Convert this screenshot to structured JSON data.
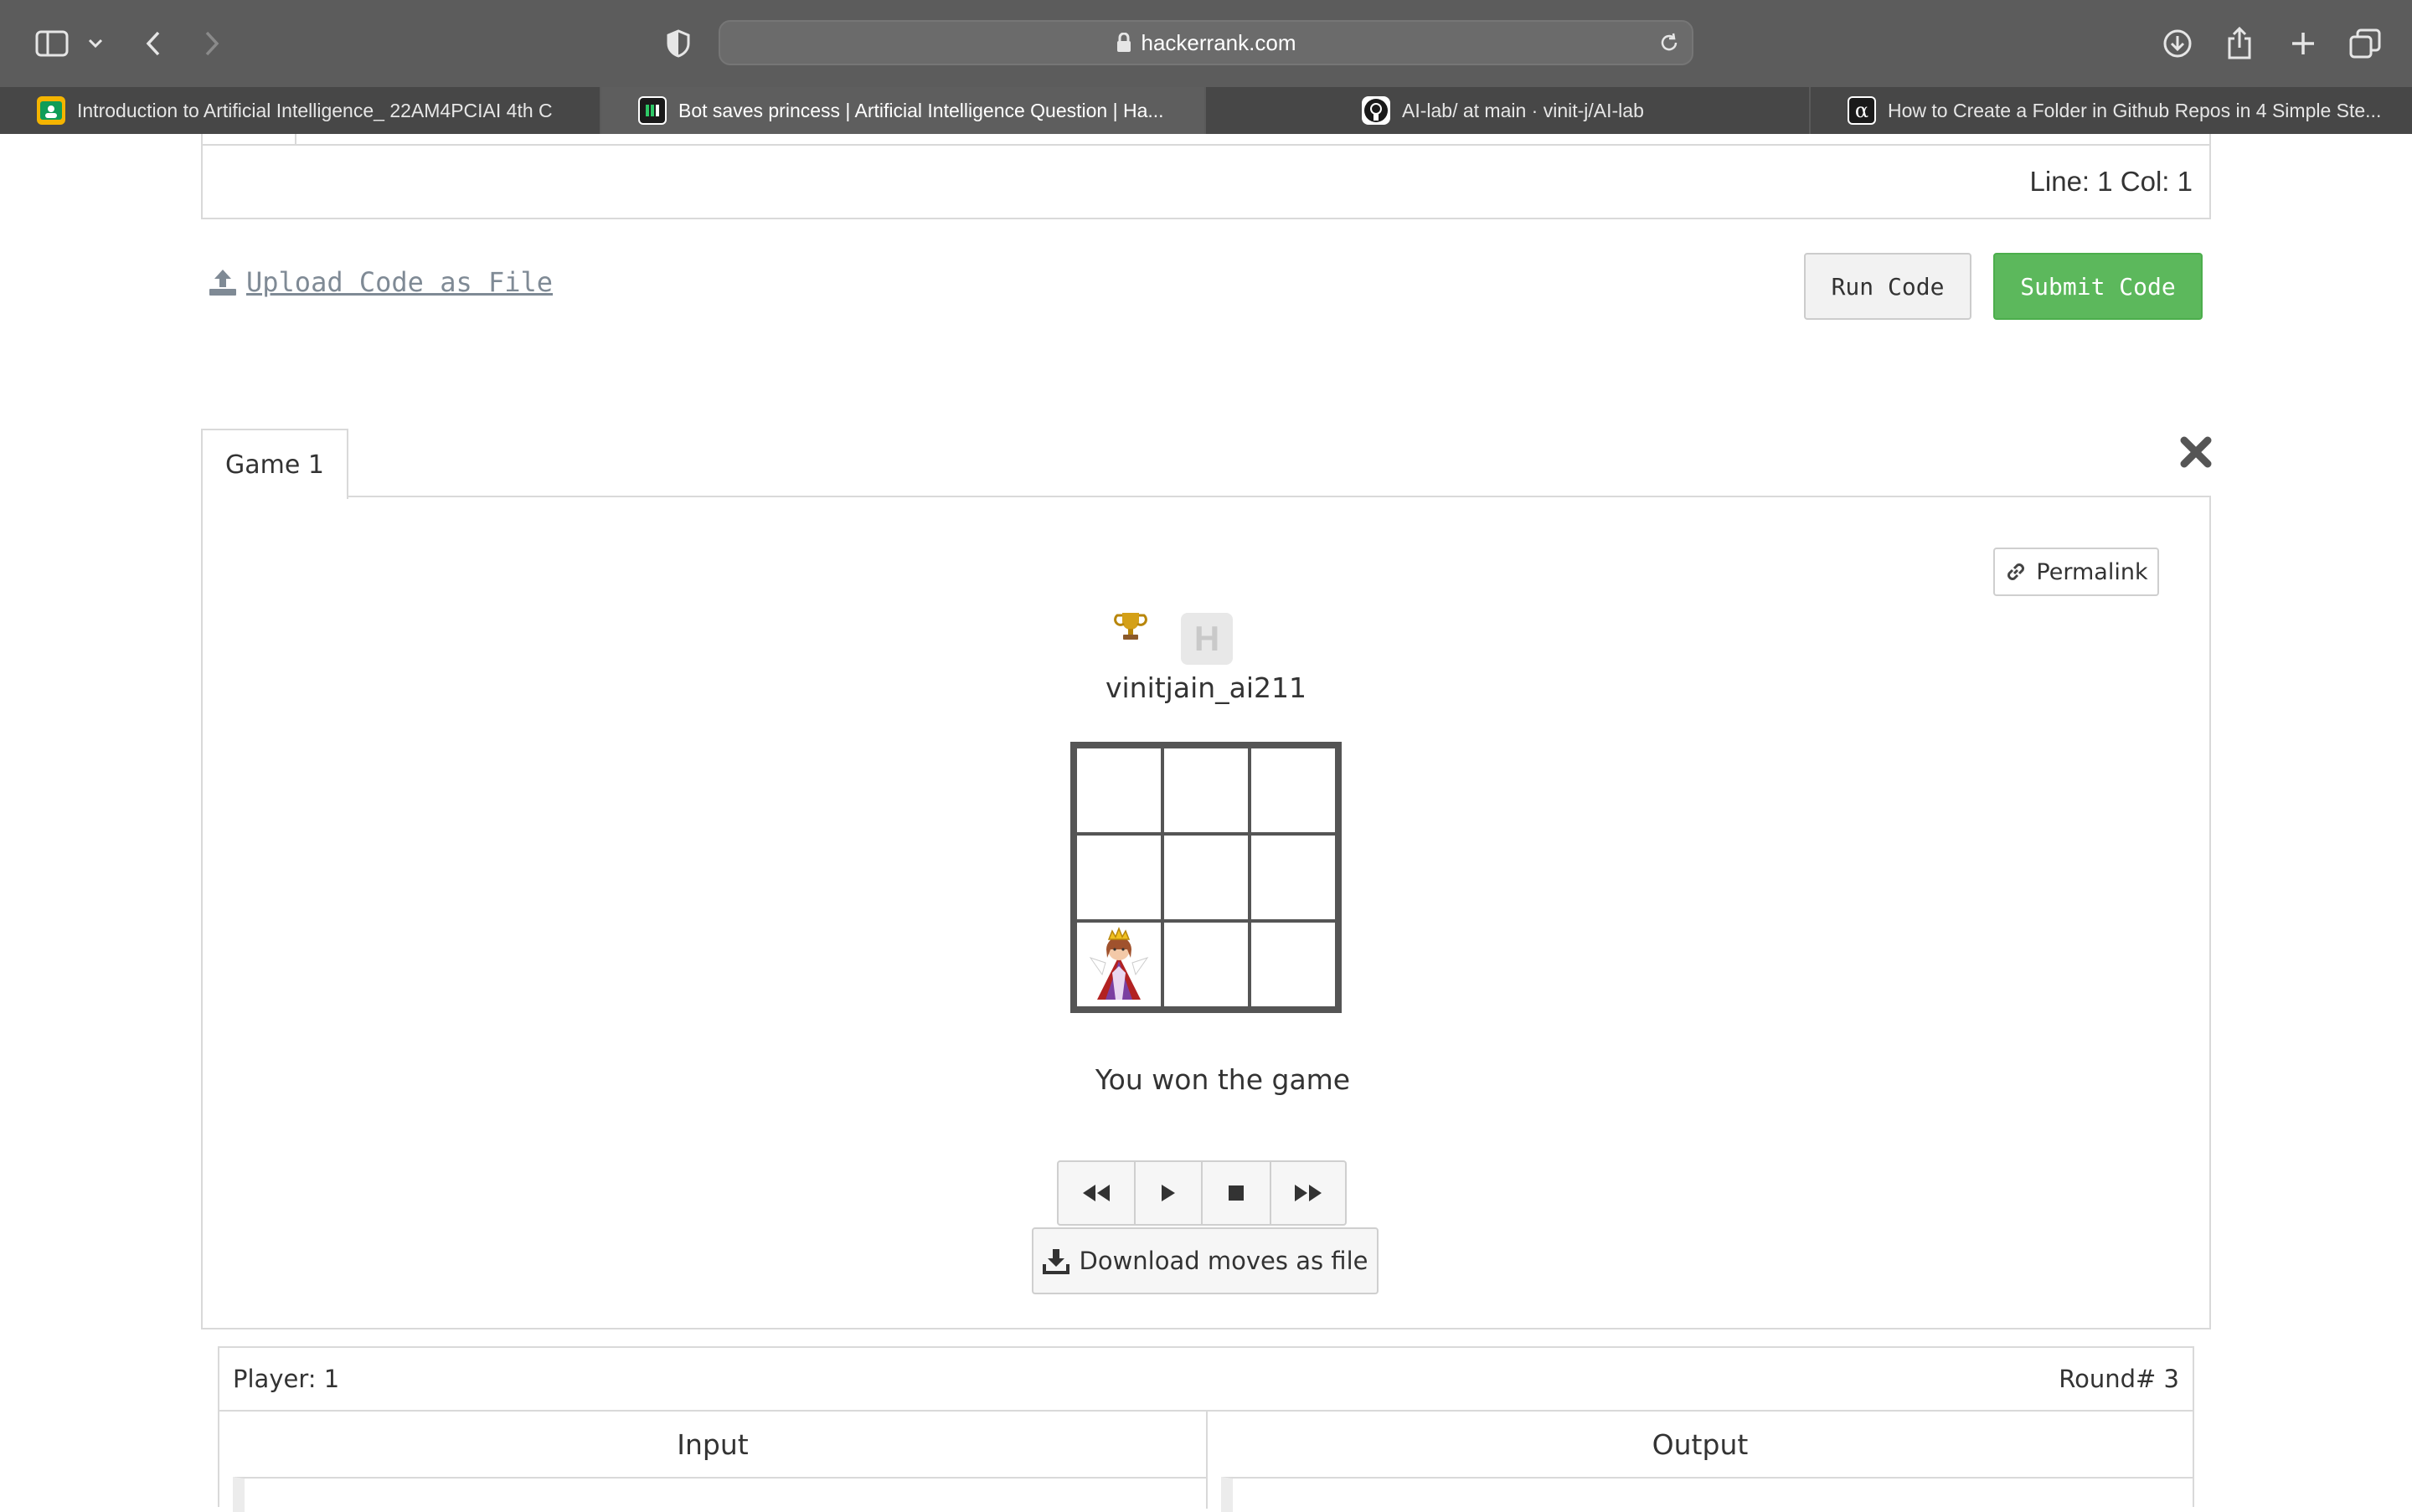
{
  "browser": {
    "url": "hackerrank.com",
    "tabs": [
      {
        "label": "Introduction to Artificial Intelligence_ 22AM4PCIAI 4th C",
        "favicon": "classroom-icon",
        "active": false
      },
      {
        "label": "Bot saves princess | Artificial Intelligence Question | Ha...",
        "favicon": "hackerrank-icon",
        "active": true
      },
      {
        "label": "AI-lab/ at main · vinit-j/AI-lab",
        "favicon": "github-icon",
        "active": false
      },
      {
        "label": "How to Create a Folder in Github Repos in 4 Simple Ste...",
        "favicon": "alpha-icon",
        "active": false
      }
    ]
  },
  "editor": {
    "status": "Line: 1 Col: 1"
  },
  "actions": {
    "upload_label": "Upload Code as File",
    "run_label": "Run Code",
    "submit_label": "Submit Code"
  },
  "game": {
    "tab_label": "Game 1",
    "permalink_label": "Permalink",
    "player_logo_letter": "H",
    "player_name": "vinitjain_ai211",
    "board": {
      "rows": 3,
      "cols": 3,
      "princess_cell": {
        "row": 2,
        "col": 0
      }
    },
    "result": "You won the game",
    "controls": [
      "rewind-icon",
      "play-icon",
      "stop-icon",
      "fast-forward-icon"
    ],
    "download_label": "Download moves as file"
  },
  "io": {
    "player": "Player: 1",
    "round": "Round# 3",
    "input_header": "Input",
    "output_header": "Output"
  },
  "colors": {
    "chrome_toolbar": "#5c5c5c",
    "tab_bar": "#474747",
    "submit_green": "#5cb85c",
    "link_gray": "#7f8a95"
  }
}
